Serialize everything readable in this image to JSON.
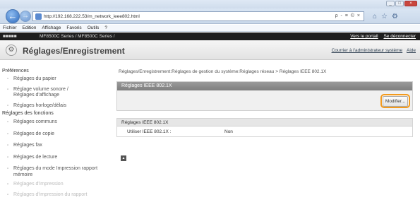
{
  "browser": {
    "url": "http://192.168.222.53/m_network_ieee802.html",
    "address_tools": "ρ - ≡ © ×",
    "menu": [
      "Fichier",
      "Edition",
      "Affichage",
      "Favoris",
      "Outils",
      "?"
    ]
  },
  "header": {
    "model": "MF8500C Series /",
    "models": "MF8500C Series / MF8500C Series /",
    "portal_link": "Vers le portail",
    "logout_link": "Se déconnecter",
    "page_title": "Réglages/Enregistrement",
    "mail_admin_link": "Courrier à l'administrateur système",
    "help_link": "Aide"
  },
  "sidebar": {
    "preferences_title": "Préférences",
    "preferences_items": [
      "Réglages du papier",
      "Réglage volume sonore / Réglages d'affichage",
      "Réglages horloge/délais"
    ],
    "functions_title": "Réglages des fonctions",
    "functions_items": [
      "Réglages communs",
      "Réglages de copie",
      "Réglages fax",
      "Réglages de lecture",
      "Réglages du mode Impression rapport mémoire",
      "Réglages d'impression",
      "Réglages d'impression du rapport"
    ]
  },
  "main": {
    "breadcrumb": "Réglages/Enregistrement:Réglages de gestion du système:Réglages réseau > Réglages IEEE 802.1X",
    "section_header": "Réglages IEEE 802.1X",
    "modify_button": "Modifier...",
    "details_header": "Réglages IEEE 802.1X",
    "row_label": "Utiliser IEEE 802.1X :",
    "row_value": "Non",
    "top_button": "▲"
  }
}
